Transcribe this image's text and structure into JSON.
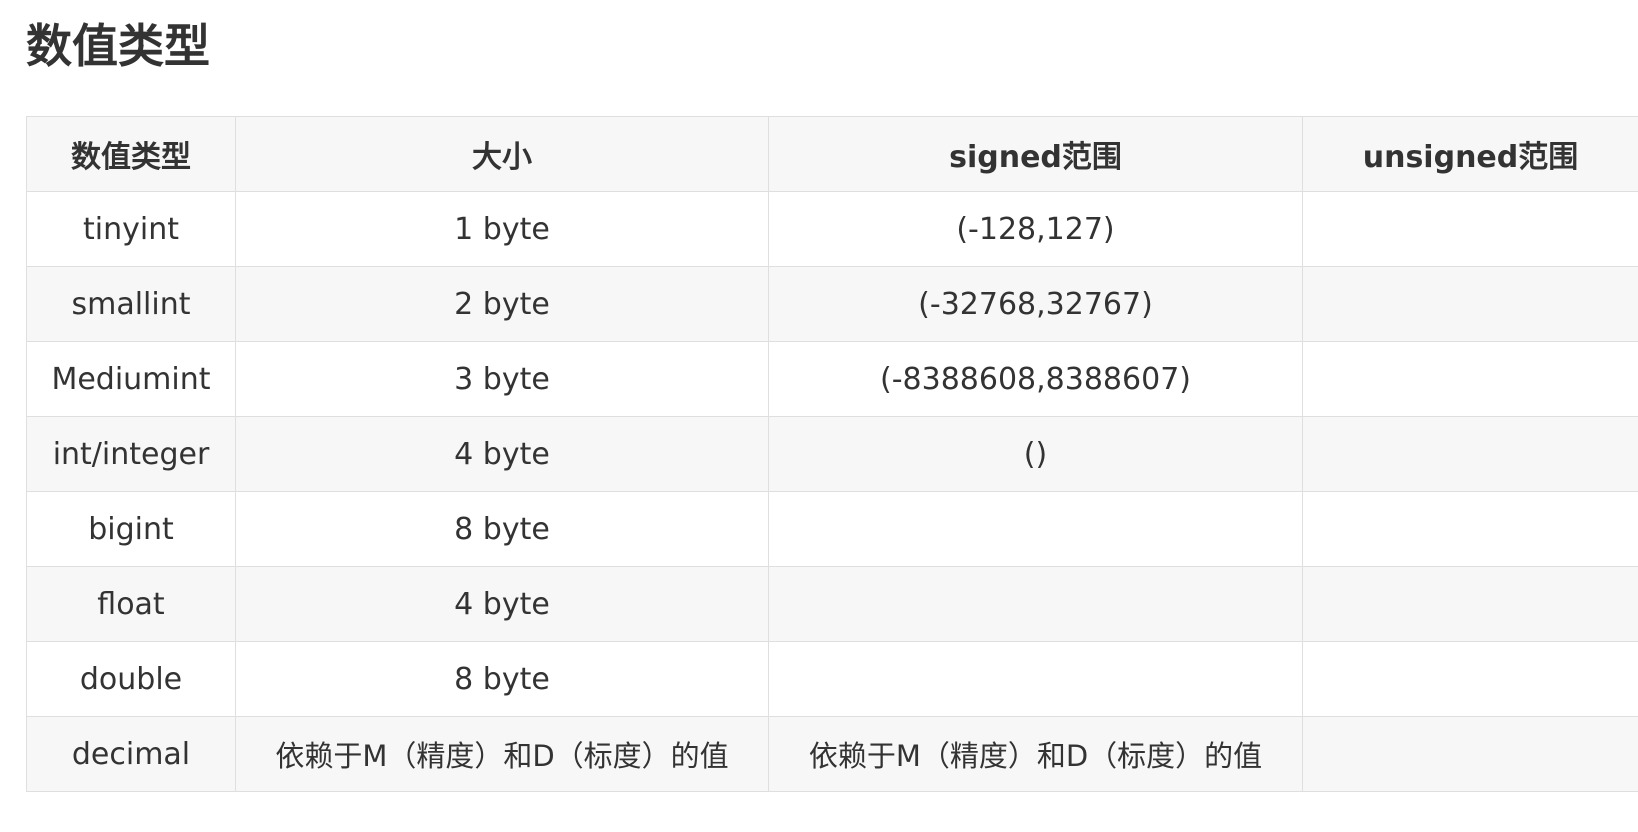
{
  "page": {
    "title": "数值类型"
  },
  "table": {
    "headers": [
      "数值类型",
      "大小",
      "signed范围",
      "unsigned范围"
    ],
    "rows": [
      [
        "tinyint",
        "1 byte",
        "(-128,127)",
        ""
      ],
      [
        "smallint",
        "2 byte",
        "(-32768,32767)",
        ""
      ],
      [
        "Mediumint",
        "3 byte",
        "(-8388608,8388607)",
        ""
      ],
      [
        "int/integer",
        "4 byte",
        "()",
        ""
      ],
      [
        "bigint",
        "8 byte",
        "",
        ""
      ],
      [
        "float",
        "4 byte",
        "",
        ""
      ],
      [
        "double",
        "8 byte",
        "",
        ""
      ],
      [
        "decimal",
        "依赖于M（精度）和D（标度）的值",
        "依赖于M（精度）和D（标度）的值",
        ""
      ]
    ]
  },
  "colors": {
    "text": "#333333",
    "border": "#dfdfdf",
    "stripe": "#f7f7f7"
  }
}
